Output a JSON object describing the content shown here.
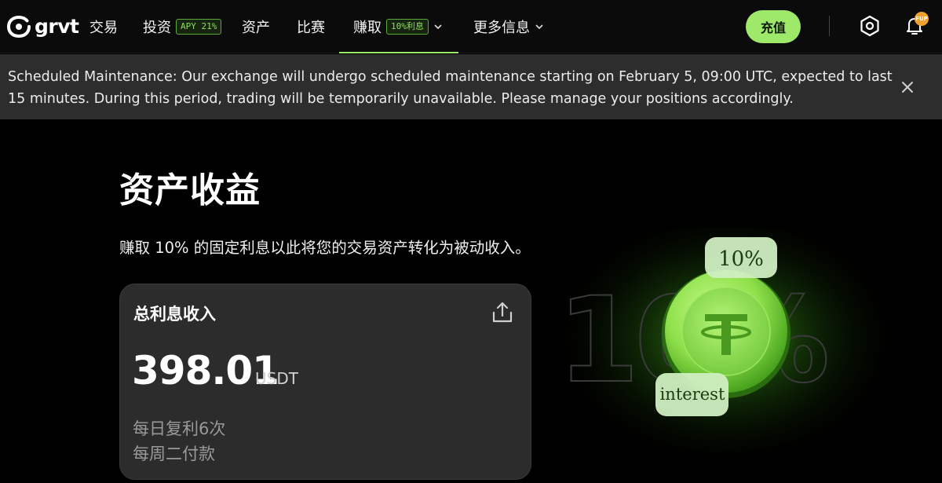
{
  "nav": {
    "logo": "grvt",
    "items": [
      {
        "label": "交易"
      },
      {
        "label": "投资",
        "badge": "APY 21%"
      },
      {
        "label": "资产"
      },
      {
        "label": "比赛"
      },
      {
        "label": "赚取",
        "badge": "10%利息",
        "active": true
      },
      {
        "label": "更多信息"
      }
    ],
    "deposit_label": "充值",
    "notification_badge": "FUP"
  },
  "banner": {
    "text": "Scheduled Maintenance: Our exchange will undergo scheduled maintenance starting on February 5, 09:00 UTC, expected to last 15 minutes. During this period, trading will be temporarily unavailable. Please manage your positions accordingly."
  },
  "main": {
    "title": "资产收益",
    "subtitle": "赚取 10% 的固定利息以此将您的交易资产转化为被动收入。",
    "card": {
      "title": "总利息收入",
      "amount": "398.01",
      "unit": "USDT",
      "note1": "每日复利6次",
      "note2": "每周二付款"
    }
  },
  "illustration": {
    "big_text": "10%",
    "bubble_top": "10%",
    "bubble_bottom": "interest"
  },
  "colors": {
    "accent": "#9ee86a",
    "background": "#000000",
    "banner": "#2d2d2d",
    "card": "#2c2c2c"
  }
}
